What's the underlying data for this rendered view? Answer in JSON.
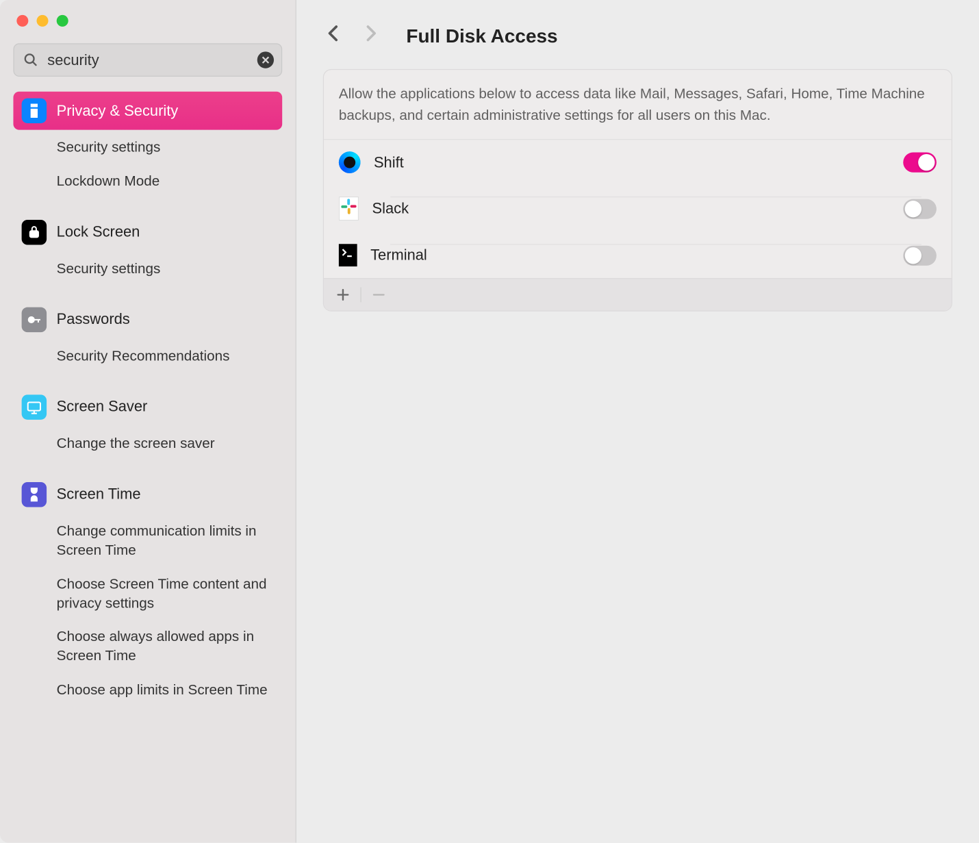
{
  "search": {
    "value": "security"
  },
  "sidebar": [
    {
      "icon": "privacy-icon",
      "iconClass": "ico-privacy",
      "label": "Privacy & Security",
      "selected": true,
      "subs": [
        "Security settings",
        "Lockdown Mode"
      ]
    },
    {
      "icon": "lock-screen-icon",
      "iconClass": "ico-lockscr",
      "label": "Lock Screen",
      "subs": [
        "Security settings"
      ]
    },
    {
      "icon": "passwords-icon",
      "iconClass": "ico-passwords",
      "label": "Passwords",
      "subs": [
        "Security Recommendations"
      ]
    },
    {
      "icon": "screen-saver-icon",
      "iconClass": "ico-scrsaver",
      "label": "Screen Saver",
      "subs": [
        "Change the screen saver"
      ]
    },
    {
      "icon": "screen-time-icon",
      "iconClass": "ico-scrtime",
      "label": "Screen Time",
      "subs": [
        "Change communication limits in Screen Time",
        "Choose Screen Time content and privacy settings",
        "Choose always allowed apps in Screen Time",
        "Choose app limits in Screen Time"
      ]
    }
  ],
  "header": {
    "title": "Full Disk Access"
  },
  "panel": {
    "description": "Allow the applications below to access data like Mail, Messages, Safari, Home, Time Machine backups, and certain administrative settings for all users on this Mac.",
    "apps": [
      {
        "name": "Shift",
        "iconClass": "ic-shift",
        "on": true
      },
      {
        "name": "Slack",
        "iconClass": "ic-slack",
        "on": false
      },
      {
        "name": "Terminal",
        "iconClass": "ic-terminal",
        "on": false
      }
    ]
  }
}
